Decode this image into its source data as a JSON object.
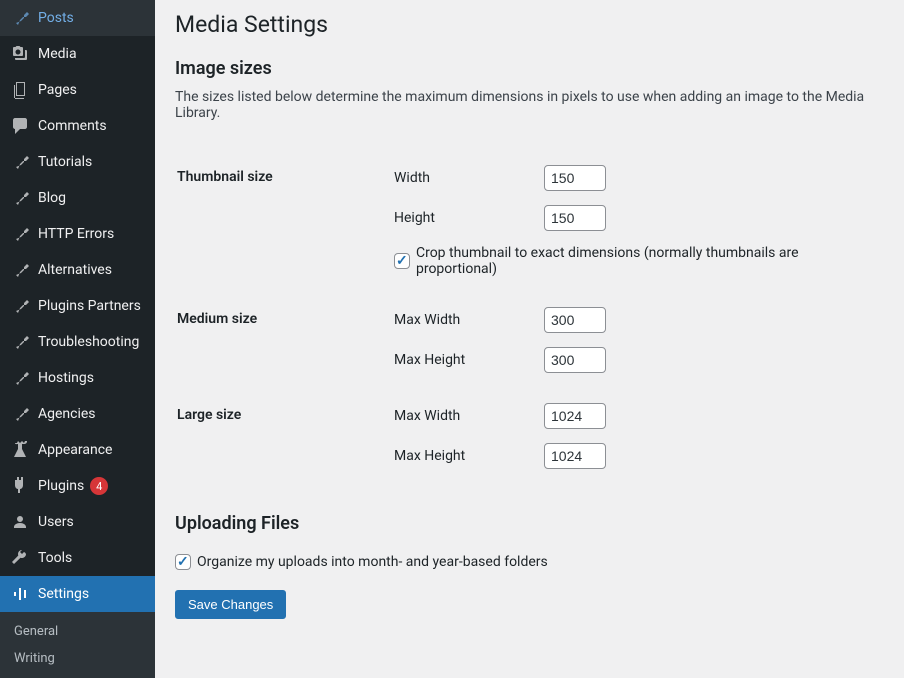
{
  "sidebar": {
    "items": [
      {
        "label": "Posts",
        "icon": "pushpin"
      },
      {
        "label": "Media",
        "icon": "media"
      },
      {
        "label": "Pages",
        "icon": "page"
      },
      {
        "label": "Comments",
        "icon": "comment"
      },
      {
        "label": "Tutorials",
        "icon": "pushpin"
      },
      {
        "label": "Blog",
        "icon": "pushpin"
      },
      {
        "label": "HTTP Errors",
        "icon": "pushpin"
      },
      {
        "label": "Alternatives",
        "icon": "pushpin"
      },
      {
        "label": "Plugins Partners",
        "icon": "pushpin"
      },
      {
        "label": "Troubleshooting",
        "icon": "pushpin"
      },
      {
        "label": "Hostings",
        "icon": "pushpin"
      },
      {
        "label": "Agencies",
        "icon": "pushpin"
      },
      {
        "label": "Appearance",
        "icon": "appearance"
      },
      {
        "label": "Plugins",
        "icon": "plugins",
        "badge": "4"
      },
      {
        "label": "Users",
        "icon": "users"
      },
      {
        "label": "Tools",
        "icon": "tools"
      },
      {
        "label": "Settings",
        "icon": "settings",
        "active": true
      }
    ],
    "submenu": [
      "General",
      "Writing"
    ]
  },
  "page": {
    "title": "Media Settings",
    "section1": {
      "heading": "Image sizes",
      "description": "The sizes listed below determine the maximum dimensions in pixels to use when adding an image to the Media Library."
    },
    "thumbnail": {
      "label": "Thumbnail size",
      "width_label": "Width",
      "width_value": "150",
      "height_label": "Height",
      "height_value": "150",
      "crop_label": "Crop thumbnail to exact dimensions (normally thumbnails are proportional)",
      "crop_checked": true
    },
    "medium": {
      "label": "Medium size",
      "maxw_label": "Max Width",
      "maxw_value": "300",
      "maxh_label": "Max Height",
      "maxh_value": "300"
    },
    "large": {
      "label": "Large size",
      "maxw_label": "Max Width",
      "maxw_value": "1024",
      "maxh_label": "Max Height",
      "maxh_value": "1024"
    },
    "section2": {
      "heading": "Uploading Files",
      "organize_label": "Organize my uploads into month- and year-based folders",
      "organize_checked": true
    },
    "save_button": "Save Changes"
  }
}
